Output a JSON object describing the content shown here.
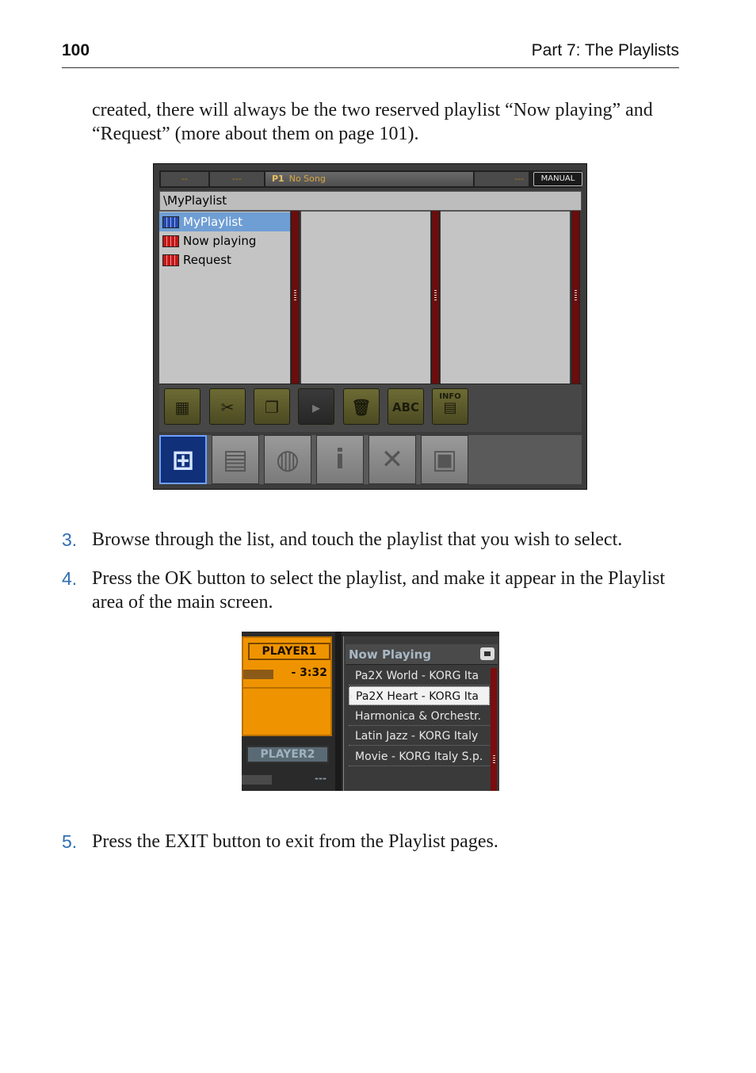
{
  "header": {
    "page_number": "100",
    "section_title": "Part 7: The Playlists"
  },
  "intro_text": "created, there will always be the two reserved playlist “Now playing” and “Request” (more about them on page 101).",
  "screen1": {
    "top_bar": {
      "seg_a": "--",
      "seg_b": "---",
      "player": "P1",
      "song": "No Song",
      "seg_right": "---",
      "mode": "MANUAL"
    },
    "path": "\\MyPlaylist",
    "items": [
      {
        "label": "MyPlaylist",
        "icon": "playlist-icon-blue",
        "selected": true
      },
      {
        "label": "Now playing",
        "icon": "playlist-icon-red",
        "selected": false
      },
      {
        "label": "Request",
        "icon": "playlist-icon-red",
        "selected": false
      }
    ],
    "toolbar": {
      "abc_label": "ABC",
      "info_label": "INFO"
    }
  },
  "steps": [
    {
      "number": "3.",
      "text": "Browse through the list, and touch the playlist that you wish to select."
    },
    {
      "number": "4.",
      "text": "Press the OK button to select the playlist, and make it appear in the Playlist area of the main screen."
    },
    {
      "number": "5.",
      "text": "Press the EXIT button to exit from the Playlist pages."
    }
  ],
  "screen2": {
    "player1": {
      "label": "PLAYER1",
      "time": "- 3:32"
    },
    "player2": {
      "label": "PLAYER2",
      "time": "---"
    },
    "list_title": "Now Playing",
    "songs": [
      {
        "title": "Pa2X World - KORG Ita",
        "selected": false
      },
      {
        "title": "Pa2X Heart - KORG Ita",
        "selected": true
      },
      {
        "title": "Harmonica & Orchestr.",
        "selected": false
      },
      {
        "title": "Latin Jazz - KORG Italy",
        "selected": false
      },
      {
        "title": "Movie - KORG Italy S.p.",
        "selected": false
      }
    ]
  },
  "colors": {
    "step_number": "#2f6fb3",
    "selected_row": "#6f9ed4",
    "player1_orange": "#ef9400",
    "scrollbar_red": "#7a0d0d"
  }
}
